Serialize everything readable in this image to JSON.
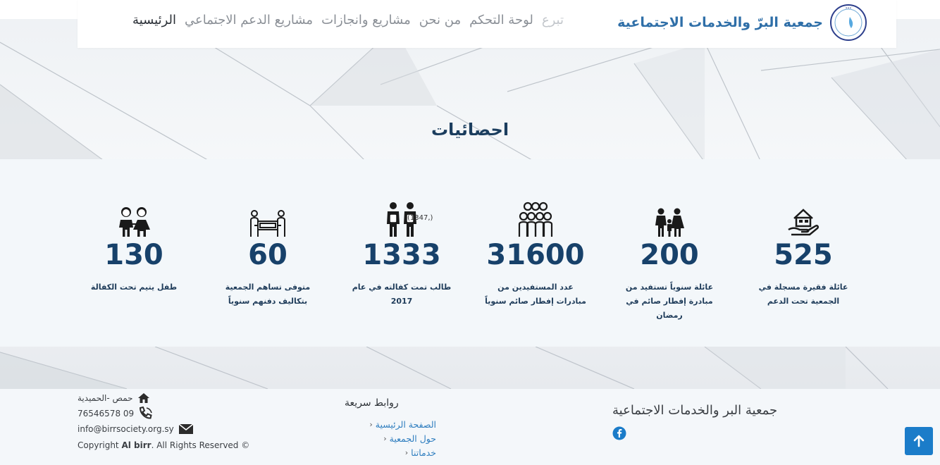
{
  "brand": {
    "name": "جمعية البرّ والخدمات الاجتماعية"
  },
  "nav": {
    "items": [
      {
        "label": "الرئيسية"
      },
      {
        "label": "مشاريع الدعم الاجتماعي"
      },
      {
        "label": "مشاريع وانجازات"
      },
      {
        "label": "من نحن"
      },
      {
        "label": "لوحة التحكم"
      },
      {
        "label": "تبرع"
      }
    ]
  },
  "stats": {
    "title": "احصائيات",
    "items": [
      {
        "icon": "house-hand-icon",
        "value": "525",
        "label": "عائلة فقيرة مسجلة في الجمعية تحت الدعم"
      },
      {
        "icon": "family-icon",
        "value": "200",
        "label": "عائلة سنوياً تستفيد من مبادرة إفطار صائم في رمضان"
      },
      {
        "icon": "group-people-icon",
        "value": "31600",
        "label": "عدد المستفيدين من مبادرات إفطار صائم سنوياً"
      },
      {
        "icon": "students-icon",
        "value": "1333",
        "note": "(1347,)",
        "label": "طالب تمت كفالته في عام 2017"
      },
      {
        "icon": "coffin-bearers-icon",
        "value": "60",
        "label": "متوفى تساهم الجمعية بتكاليف دفنهم سنوياً"
      },
      {
        "icon": "children-icon",
        "value": "130",
        "label": "طفل يتيم تحت الكفالة"
      }
    ]
  },
  "footer": {
    "address": "حمص -الحميدية",
    "phone": "76546578 09",
    "email": "info@birrsociety.org.sy",
    "copyright_prefix": "Copyright ",
    "copyright_brand": "Al birr",
    "copyright_suffix": ". All Rights Reserved ©",
    "quick_links_title": "روابط سريعة",
    "quick_links": [
      "الصفحة الرئيسية",
      "حول الجمعية",
      "خدماتنا"
    ],
    "org_name": "جمعية البر والخدمات الاجتماعية"
  },
  "colors": {
    "accent": "#1b7cc9",
    "title": "#1b3d5e",
    "stat_value": "#17416a",
    "link": "#2f7ebf"
  }
}
